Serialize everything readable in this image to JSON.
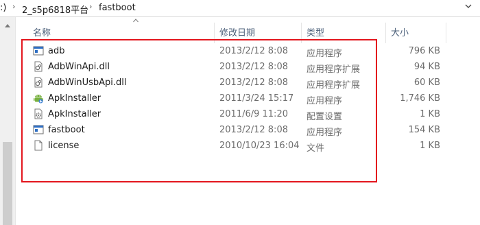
{
  "breadcrumb": {
    "partial": ":)",
    "folder": "2_s5p6818平台",
    "current": "fastboot"
  },
  "columns": {
    "name": "名称",
    "modified": "修改日期",
    "type": "类型",
    "size": "大小"
  },
  "files": [
    {
      "name": "adb",
      "modified": "2013/2/12 8:08",
      "type": "应用程序",
      "size": "796 KB",
      "icon": "exe-icon"
    },
    {
      "name": "AdbWinApi.dll",
      "modified": "2013/2/12 8:08",
      "type": "应用程序扩展",
      "size": "94 KB",
      "icon": "dll-icon"
    },
    {
      "name": "AdbWinUsbApi.dll",
      "modified": "2013/2/12 8:08",
      "type": "应用程序扩展",
      "size": "60 KB",
      "icon": "dll-icon"
    },
    {
      "name": "ApkInstaller",
      "modified": "2011/3/24 15:17",
      "type": "应用程序",
      "size": "1,746 KB",
      "icon": "android-icon"
    },
    {
      "name": "ApkInstaller",
      "modified": "2011/6/9 11:20",
      "type": "配置设置",
      "size": "1 KB",
      "icon": "config-file-icon"
    },
    {
      "name": "fastboot",
      "modified": "2013/2/12 8:08",
      "type": "应用程序",
      "size": "154 KB",
      "icon": "exe-icon"
    },
    {
      "name": "license",
      "modified": "2010/10/23 16:04",
      "type": "文件",
      "size": "1 KB",
      "icon": "blank-file-icon"
    }
  ],
  "colors": {
    "highlight": "#e3151d",
    "header_text": "#4c607a"
  }
}
